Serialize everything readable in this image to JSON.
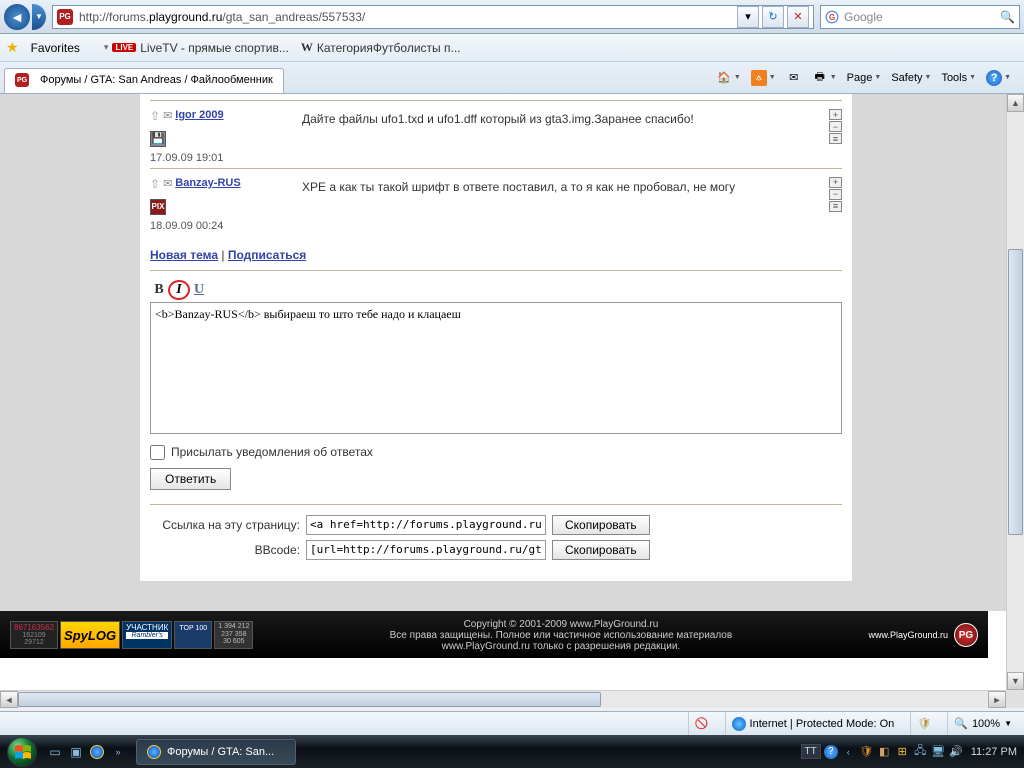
{
  "browser": {
    "url_prefix": "http://forums.",
    "url_host": "playground.ru",
    "url_path": "/gta_san_andreas/557533/",
    "search_placeholder": "Google"
  },
  "favorites": {
    "label": "Favorites",
    "item1": "LiveTV - прямые спортив...",
    "item2": "КатегорияФутболисты п..."
  },
  "tab": {
    "title": "Форумы / GTA: San Andreas / Файлообменник"
  },
  "cmdbar": {
    "page": "Page",
    "safety": "Safety",
    "tools": "Tools"
  },
  "posts": [
    {
      "author": "Igor 2009",
      "msg": "Дайте файлы ufo1.txd и ufo1.dff который из gta3.img.Заранее спасибо!",
      "date": "17.09.09 19:01",
      "icon": "disk"
    },
    {
      "author": "Banzay-RUS",
      "msg": "XPE а как ты такой шрифт в ответе поставил, а то я как не пробовал, не могу",
      "date": "18.09.09 00:24",
      "icon": "pix"
    }
  ],
  "topiclinks": {
    "new": "Новая тема",
    "sub": "Подписаться"
  },
  "reply": {
    "text": "<b>Banzay-RUS</b> выбираеш то што тебе надо и клацаеш",
    "notify": "Присылать уведомления об ответах",
    "submit": "Ответить"
  },
  "share": {
    "label1": "Ссылка на эту страницу:",
    "val1": "<a href=http://forums.playground.ru/gta_san_a",
    "label2": "BBcode:",
    "val2": "[url=http://forums.playground.ru/gta_san_andre",
    "copy": "Скопировать"
  },
  "footer": {
    "line1": "Copyright © 2001-2009 www.PlayGround.ru",
    "line2": "Все права защищены. Полное или частичное использование материалов",
    "line3": "www.PlayGround.ru только с разрешения редакции.",
    "brand": "www.PlayGround.ru",
    "counter_main": "867163562",
    "counter_sub1": "162109",
    "counter_sub2": "29712",
    "spylog": "SpyLOG",
    "rambler1": "УЧАСТНИК",
    "rambler2": "Rambler's",
    "top100": "TOP 100",
    "metrika": "1 394 212\n237 358\n30 605"
  },
  "status": {
    "zone": "Internet | Protected Mode: On",
    "zoom": "100%"
  },
  "taskbar": {
    "app": "Форумы / GTA: San...",
    "lang": "TT",
    "time": "11:27 PM"
  }
}
